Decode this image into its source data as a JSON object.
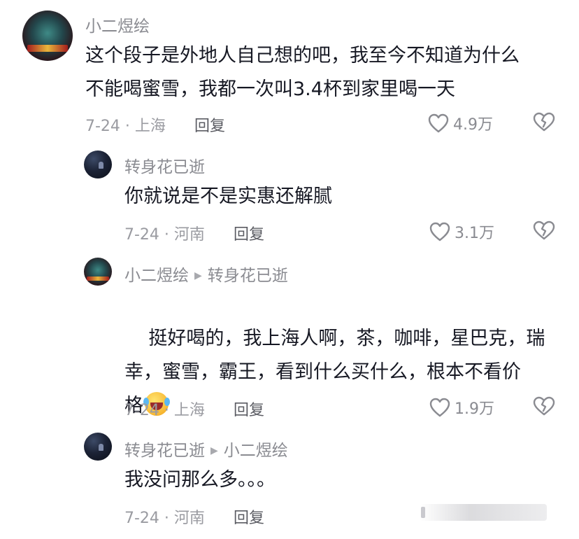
{
  "comments": [
    {
      "user": "小二煜绘",
      "reply_to": "",
      "text": "这个段子是外地人自己想的吧，我至今不知道为什么\n不能喝蜜雪，我都一次叫3.4杯到家里喝一天",
      "meta": "7-24 · 上海",
      "reply_label": "回复",
      "likes": "4.9万",
      "avatar_icon": "game-poster-avatar"
    },
    {
      "user": "转身花已逝",
      "reply_to": "",
      "text": "你就说是不是实惠还解腻",
      "meta": "7-24 · 河南",
      "reply_label": "回复",
      "likes": "3.1万",
      "avatar_icon": "night-sky-avatar"
    },
    {
      "user": "小二煜绘",
      "reply_to": "转身花已逝",
      "text": "挺好喝的，我上海人啊，茶，咖啡，星巴克，瑞\n幸，蜜雪，霸王，看到什么买什么，根本不看价\n格",
      "emoji": "laughing-crying-emoji",
      "meta": "7-24 · 上海",
      "reply_label": "回复",
      "likes": "1.9万",
      "avatar_icon": "game-poster-avatar"
    },
    {
      "user": "转身花已逝",
      "reply_to": "小二煜绘",
      "text": "我没问那么多。。。",
      "meta": "7-24 · 河南",
      "reply_label": "回复",
      "likes": "",
      "avatar_icon": "night-sky-avatar"
    }
  ],
  "colors": {
    "text": "#161823",
    "secondary": "#8a8b91",
    "background": "#ffffff"
  }
}
